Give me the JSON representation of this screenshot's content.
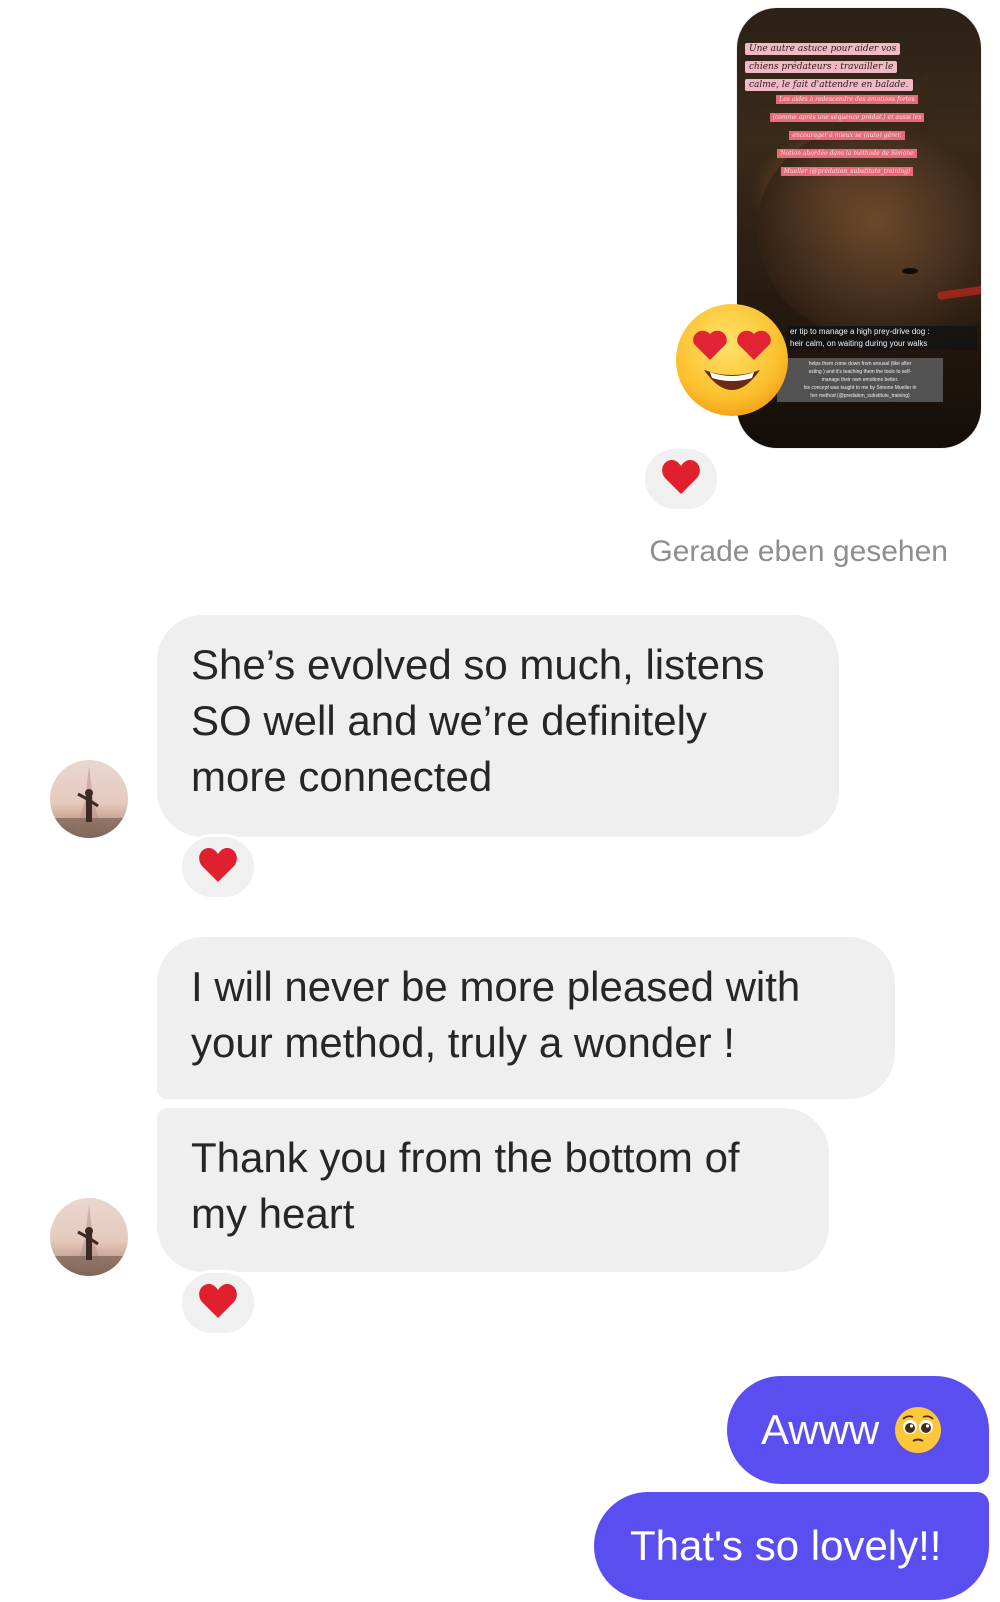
{
  "story_preview": {
    "overlay_fr_pink": [
      "Une autre astuce pour aider vos",
      "chiens prédateurs : travailler le",
      "calme, le fait d'attendre en balade."
    ],
    "overlay_fr_red": [
      "Les aides à redescendre des émotions fortes",
      "(comme après une séquence prédat.) et aussi les",
      "encourager à mieux se (auto) gérer.",
      "Notion abordée dans la méthode de Simone",
      "Mueller (@prédation_substitute_training)"
    ],
    "overlay_en_dark": [
      "er tip to manage a high prey-drive dog :",
      "heir calm, on waiting during your walks"
    ],
    "overlay_en_grey": [
      "helps them come down from arousal (like after",
      "ssting ) and it's teaching them the tools to self-",
      "manage their own emotions better.",
      "his concept was taught to me by Simone Mueller in",
      "her method (@predation_substitute_training)"
    ],
    "reaction_emoji": "heart-eyes-smiley-icon"
  },
  "story_reaction": {
    "icon": "red-heart-icon"
  },
  "seen_status": "Gerade eben gesehen",
  "messages": {
    "incoming_1": {
      "lines": [
        "She’s evolved so much, listens",
        "SO well and we’re definitely",
        "more connected"
      ],
      "reaction_icon": "red-heart-icon"
    },
    "incoming_2": {
      "lines": [
        "I will never be more pleased with",
        "your method, truly a wonder !"
      ]
    },
    "incoming_3": {
      "lines": [
        "Thank you from the bottom of",
        "my heart"
      ],
      "reaction_icon": "red-heart-icon"
    },
    "outgoing_1": {
      "text": "Awww",
      "emoji": "pleading-face-icon"
    },
    "outgoing_2": {
      "text": "That's so lovely!!"
    }
  },
  "colors": {
    "outgoing_bubble": "#5b4ef1",
    "incoming_bubble": "#efefef",
    "heart": "#e0202e",
    "seen_text": "#8e8e8e"
  }
}
